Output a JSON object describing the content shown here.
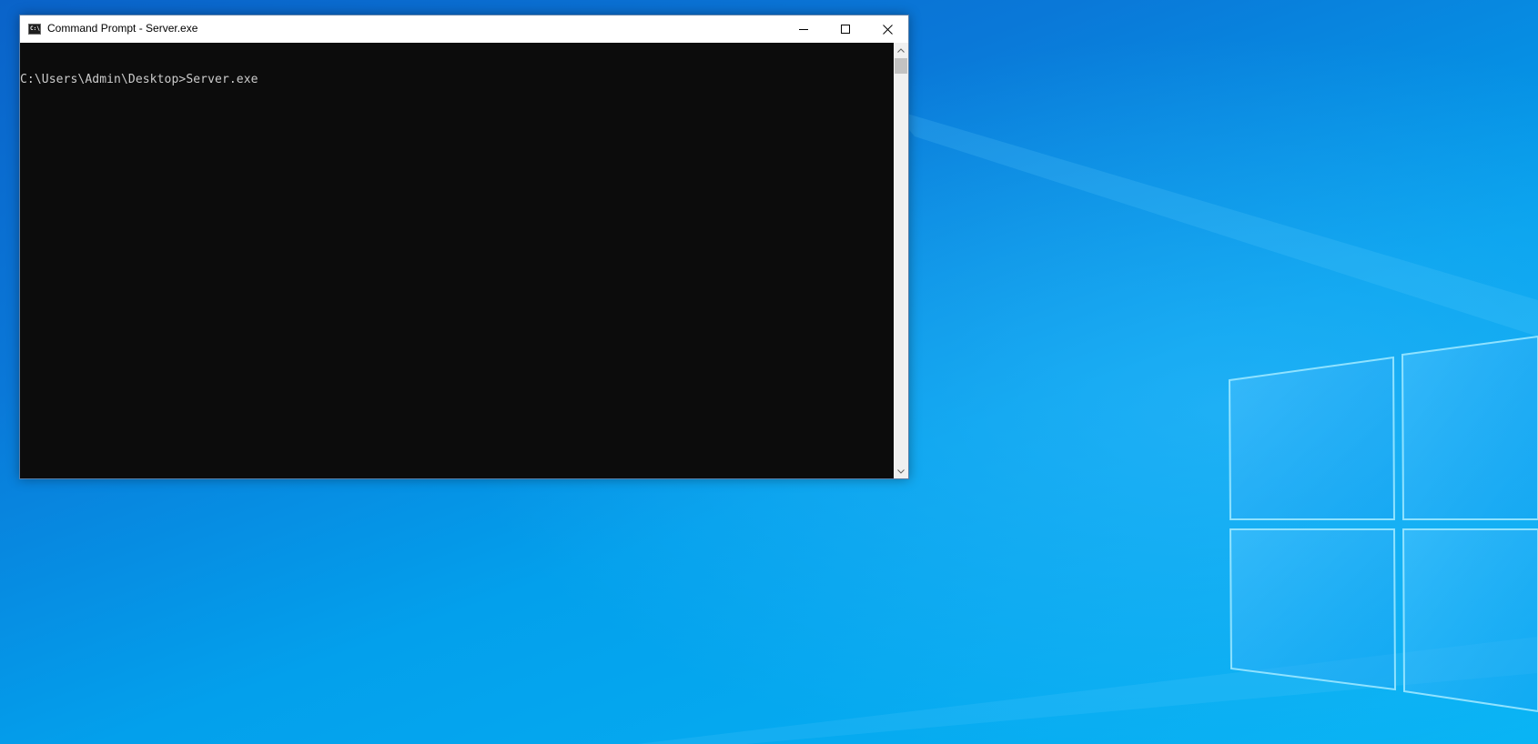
{
  "window": {
    "title": "Command Prompt - Server.exe",
    "app_icon_text": "C:\\",
    "console_lines": [
      "C:\\Users\\Admin\\Desktop>Server.exe"
    ]
  },
  "icons": {
    "app": "cmd-icon",
    "minimize": "minimize-icon",
    "maximize": "maximize-icon",
    "close": "close-icon",
    "scroll_up": "chevron-up-icon",
    "scroll_down": "chevron-down-icon"
  },
  "colors": {
    "console_bg": "#0c0c0c",
    "console_text": "#cccccc",
    "titlebar_bg": "#ffffff",
    "desktop_blue": "#0a78d8"
  }
}
